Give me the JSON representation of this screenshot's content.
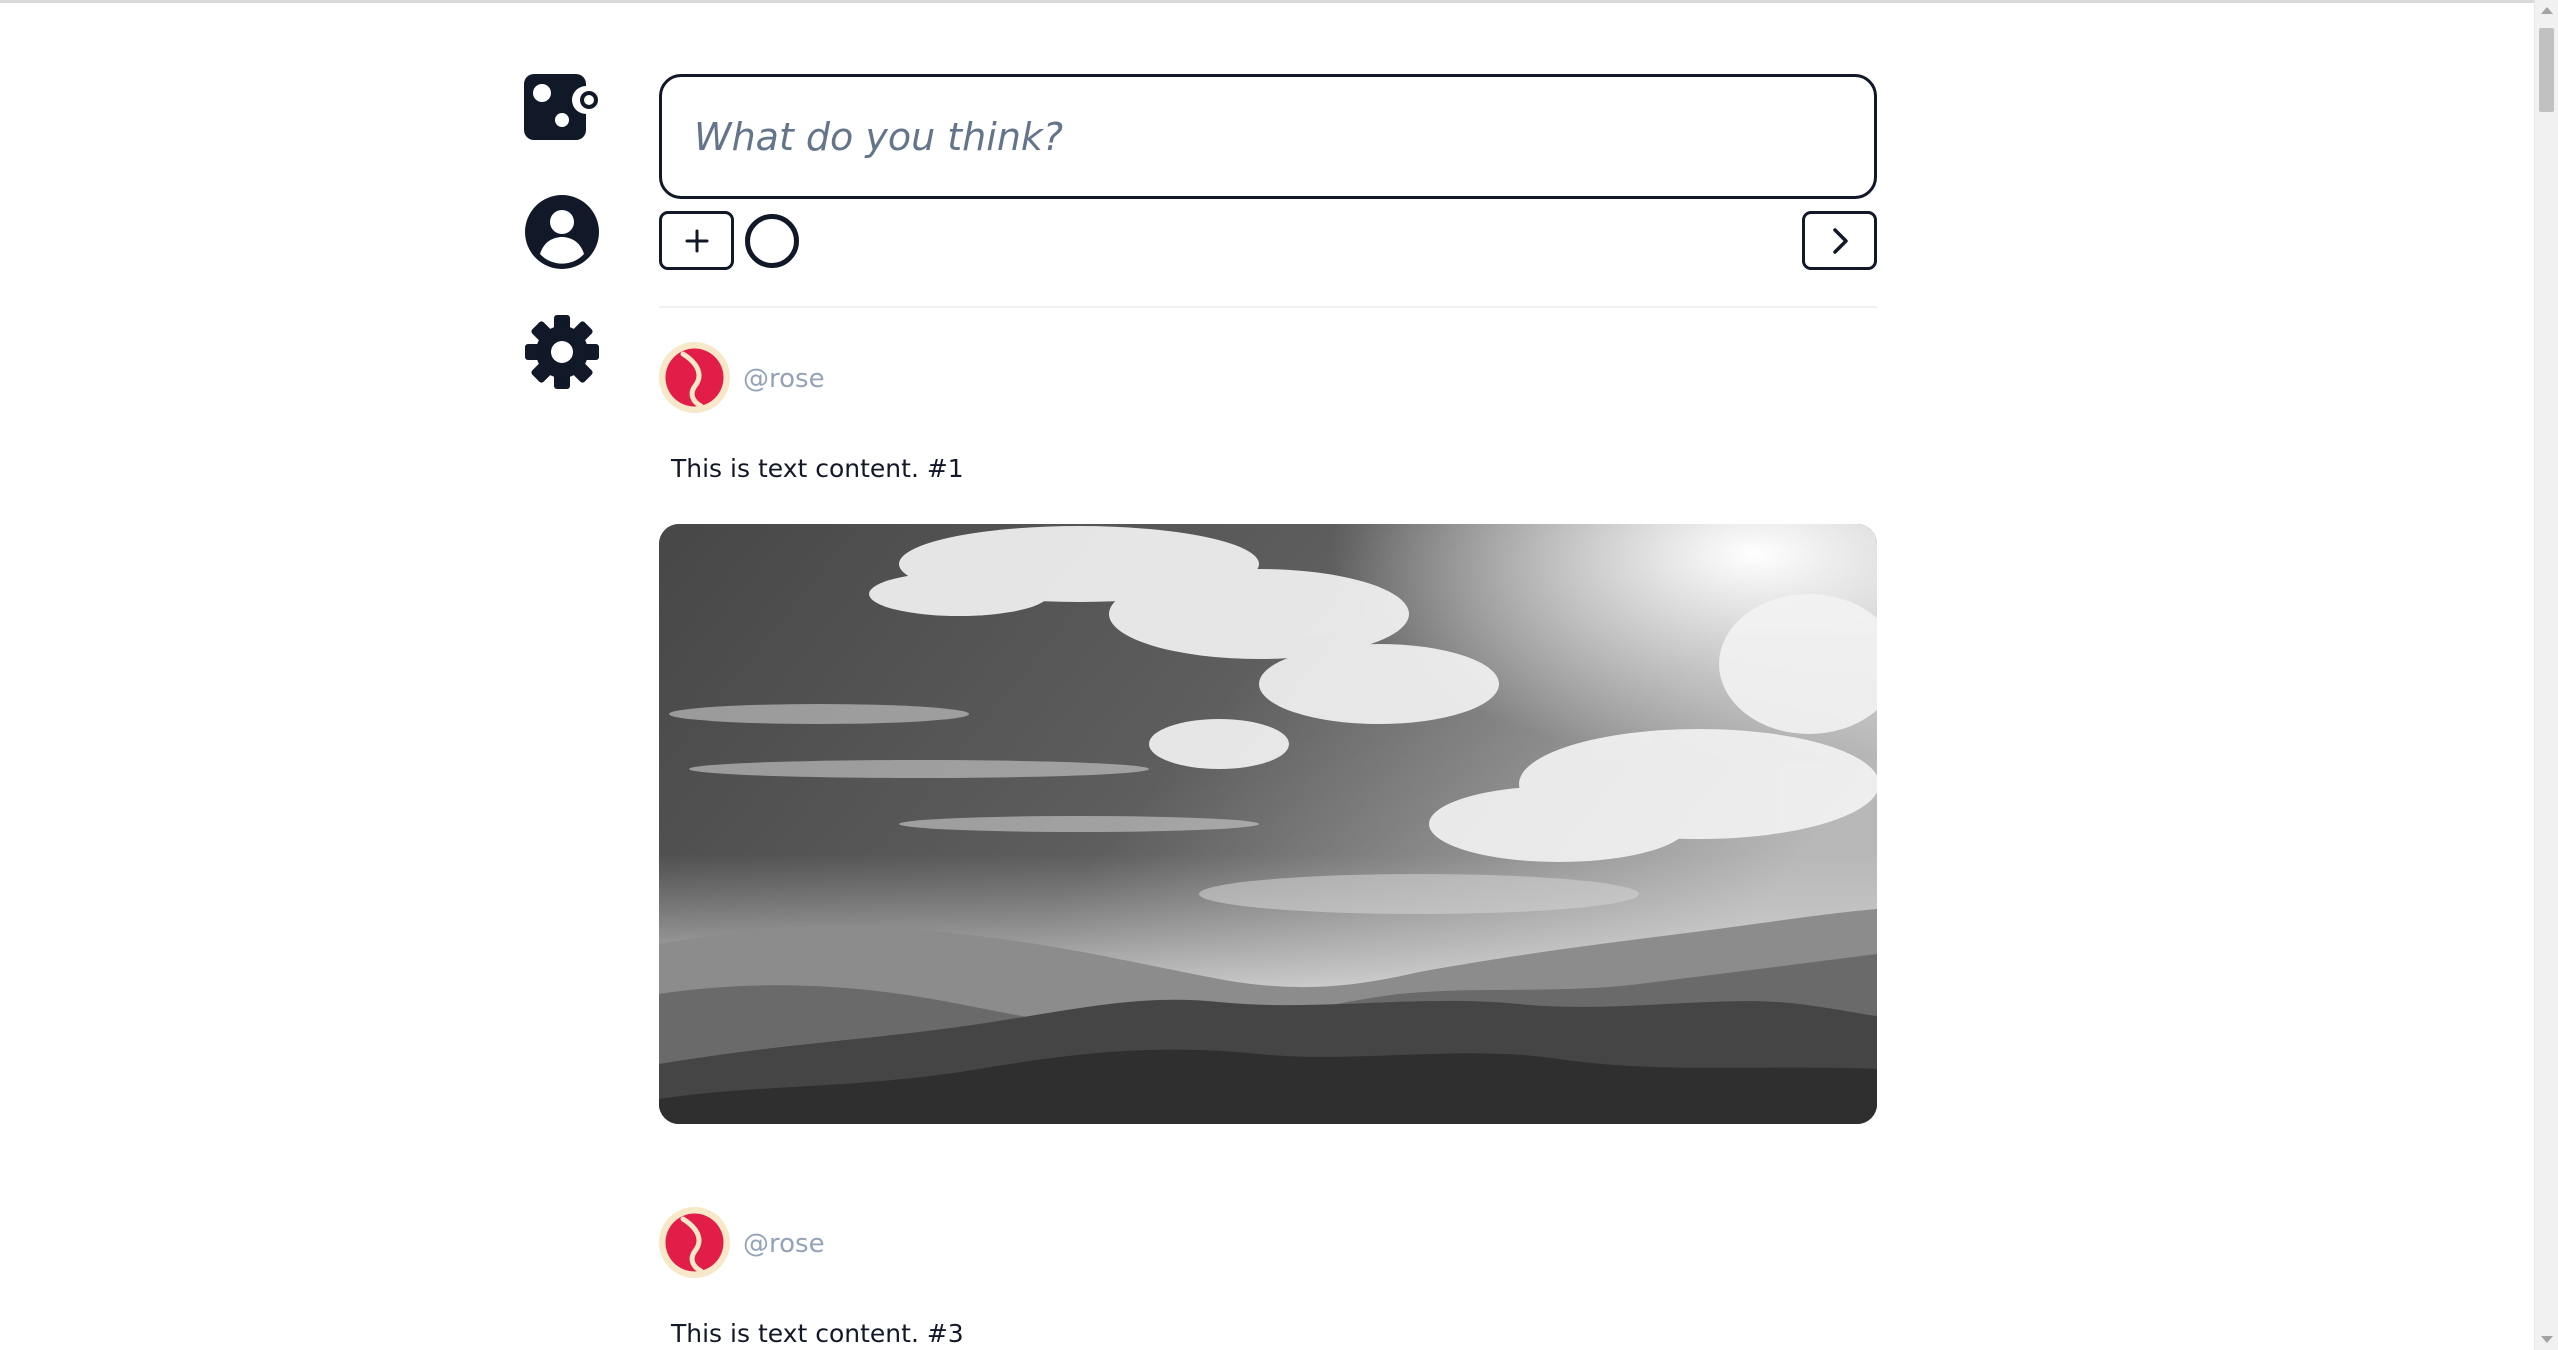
{
  "nav": {
    "items": [
      {
        "icon": "dice-icon",
        "label": ""
      },
      {
        "icon": "profile-icon",
        "label": ""
      },
      {
        "icon": "settings-gear-icon",
        "label": ""
      }
    ]
  },
  "composer": {
    "placeholder": "What do you think?",
    "value": "",
    "add_icon": "plus-icon",
    "add_symbol": "+",
    "circle_icon": "circle-icon",
    "send_icon": "chevron-right-icon"
  },
  "posts": [
    {
      "username": "@rose",
      "text": "This is text content. #1",
      "has_image": true,
      "image_icon": "landscape-photo"
    },
    {
      "username": "@rose",
      "text": "This is text content. #3",
      "has_image": false
    }
  ],
  "colors": {
    "ink": "#111827",
    "placeholder": "#64748b",
    "username": "#94a3b8",
    "avatar_bg": "#f6e8c9",
    "avatar_accent": "#e11d48",
    "divider": "#eef0f2"
  }
}
